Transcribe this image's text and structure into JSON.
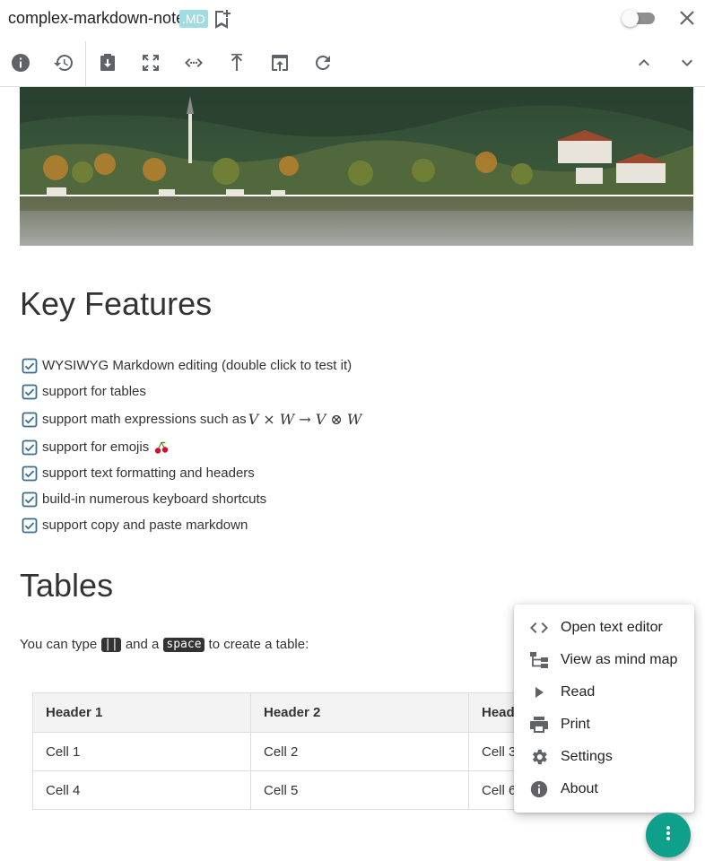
{
  "title_bar": {
    "document_title": "complex-markdown-note",
    "extension_badge": ".MD",
    "icons": [
      "bookmark-add-icon",
      "toggle-switch",
      "close-icon"
    ]
  },
  "toolbar": {
    "icons": [
      "info-icon",
      "history-icon",
      "save-download-icon",
      "fullscreen-icon",
      "code-expand-icon",
      "export-up-icon",
      "open-external-icon",
      "refresh-icon",
      "chevron-up-icon",
      "chevron-down-icon"
    ]
  },
  "content": {
    "hero_image": "landscape-lake-village-photo",
    "heading_key_features": "Key Features",
    "features": [
      {
        "text": "WYSIWYG Markdown editing (double click to test it)"
      },
      {
        "text": "support for tables"
      },
      {
        "text": "support math expressions such as"
      },
      {
        "text": "support for emojis"
      },
      {
        "text": "support text formatting and headers"
      },
      {
        "text": "build-in numerous keyboard shortcuts"
      },
      {
        "text": "support copy and paste markdown"
      }
    ],
    "math_expression": "V × W → V ⊗ W",
    "emoji": "cherries",
    "heading_tables": "Tables",
    "table_paragraph": {
      "before": "You can type",
      "kbd_pipes": "||",
      "middle": "and a",
      "kbd_space": "space",
      "after": "to create a table:"
    },
    "table": {
      "headers": [
        "Header 1",
        "Header 2",
        "Header 3"
      ],
      "rows": [
        [
          "Cell 1",
          "Cell 2",
          "Cell 3"
        ],
        [
          "Cell 4",
          "Cell 5",
          "Cell 6"
        ]
      ]
    }
  },
  "menu": {
    "items": [
      {
        "label": "Open text editor",
        "icon": "code-icon"
      },
      {
        "label": "View as mind map",
        "icon": "mind-map-icon"
      },
      {
        "label": "Read",
        "icon": "play-icon"
      },
      {
        "label": "Print",
        "icon": "print-icon"
      },
      {
        "label": "Settings",
        "icon": "gear-icon"
      },
      {
        "label": "About",
        "icon": "info-icon"
      }
    ]
  },
  "fab": {
    "icon": "more-vertical-icon"
  },
  "colors": {
    "accent": "#0fa08c",
    "badge": "#9fdde3",
    "check": "#3a6e8f",
    "icon": "#5f6368"
  }
}
